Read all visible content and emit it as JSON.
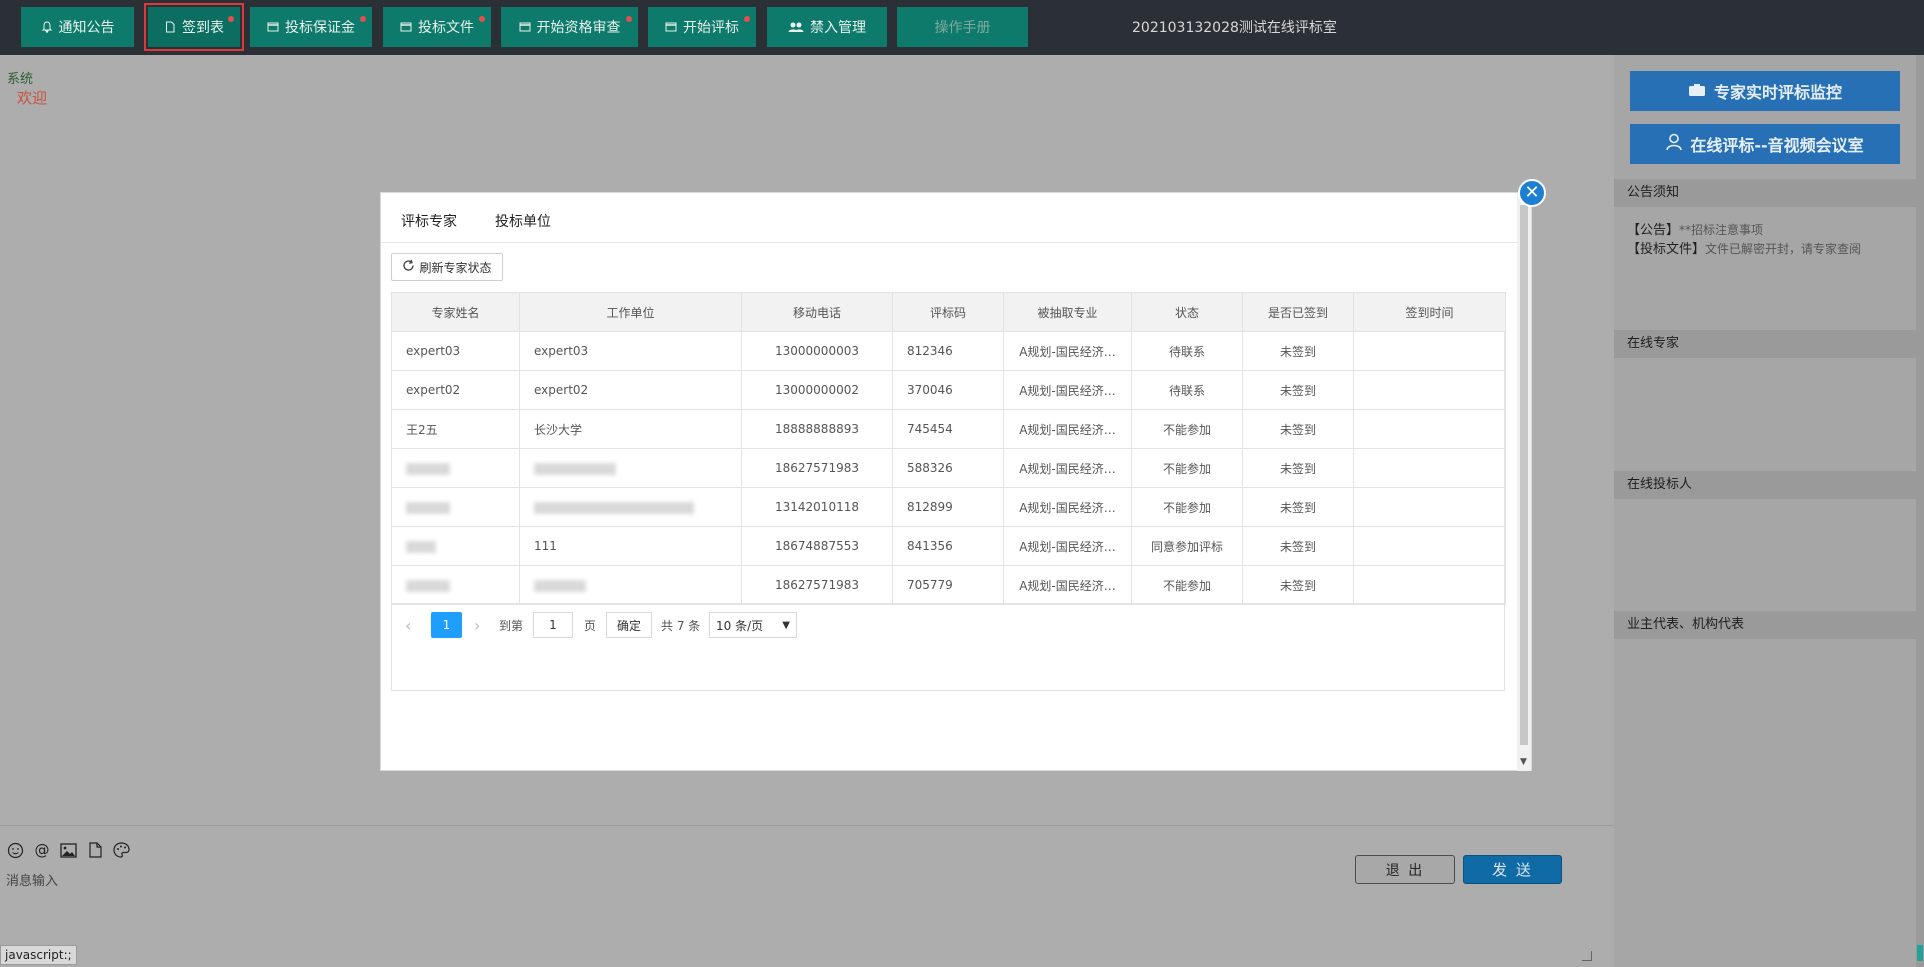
{
  "topbar": {
    "buttons": [
      {
        "label": "通知公告",
        "icon": "bell-icon"
      },
      {
        "label": "签到表",
        "icon": "file-icon"
      },
      {
        "label": "投标保证金",
        "icon": "window-icon"
      },
      {
        "label": "投标文件",
        "icon": "window-icon"
      },
      {
        "label": "开始资格审查",
        "icon": "window-icon"
      },
      {
        "label": "开始评标",
        "icon": "window-icon"
      },
      {
        "label": "禁入管理",
        "icon": "users-icon"
      },
      {
        "label": "操作手册",
        "icon": ""
      }
    ],
    "room_title": "202103132028测试在线评标室"
  },
  "chat": {
    "system_label": "系统",
    "welcome": "欢迎",
    "input_placeholder": "消息输入",
    "exit_label": "退 出",
    "send_label": "发 送",
    "tools": [
      "smile-icon",
      "at-icon",
      "image-icon",
      "file-icon",
      "palette-icon"
    ]
  },
  "right_panel": {
    "monitor_button": "专家实时评标监控",
    "video_button": "在线评标--音视频会议室",
    "notice_title": "公告须知",
    "notices": [
      {
        "tag": "【公告】",
        "text": "**招标注意事项"
      },
      {
        "tag": "【投标文件】",
        "text": "文件已解密开封，请专家查阅"
      }
    ],
    "online_experts_title": "在线专家",
    "online_bidders_title": "在线投标人",
    "owner_rep_title": "业主代表、机构代表"
  },
  "modal": {
    "tabs": [
      "评标专家",
      "投标单位"
    ],
    "refresh_label": "刷新专家状态",
    "columns": [
      "专家姓名",
      "工作单位",
      "移动电话",
      "评标码",
      "被抽取专业",
      "状态",
      "是否已签到",
      "签到时间"
    ],
    "rows": [
      {
        "name": "expert03",
        "unit": "expert03",
        "phone": "13000000003",
        "code": "812346",
        "major": "A规划-国民经济…",
        "status": "待联系",
        "signed": "未签到",
        "time": ""
      },
      {
        "name": "expert02",
        "unit": "expert02",
        "phone": "13000000002",
        "code": "370046",
        "major": "A规划-国民经济…",
        "status": "待联系",
        "signed": "未签到",
        "time": ""
      },
      {
        "name": "王2五",
        "unit": "长沙大学",
        "phone": "18888888893",
        "code": "745454",
        "major": "A规划-国民经济…",
        "status": "不能参加",
        "signed": "未签到",
        "time": ""
      },
      {
        "name": "",
        "unit": "",
        "phone": "18627571983",
        "code": "588326",
        "major": "A规划-国民经济…",
        "status": "不能参加",
        "signed": "未签到",
        "time": ""
      },
      {
        "name": "",
        "unit": "",
        "phone": "13142010118",
        "code": "812899",
        "major": "A规划-国民经济…",
        "status": "不能参加",
        "signed": "未签到",
        "time": ""
      },
      {
        "name": "",
        "unit": "111",
        "phone": "18674887553",
        "code": "841356",
        "major": "A规划-国民经济…",
        "status": "同意参加评标",
        "signed": "未签到",
        "time": ""
      },
      {
        "name": "",
        "unit": "",
        "phone": "18627571983",
        "code": "705779",
        "major": "A规划-国民经济…",
        "status": "不能参加",
        "signed": "未签到",
        "time": ""
      }
    ],
    "pager": {
      "current": "1",
      "goto_label": "到第",
      "goto_value": "1",
      "page_unit": "页",
      "confirm": "确定",
      "total": "共 7 条",
      "page_size": "10 条/页"
    }
  },
  "statusbar": "javascript:;"
}
